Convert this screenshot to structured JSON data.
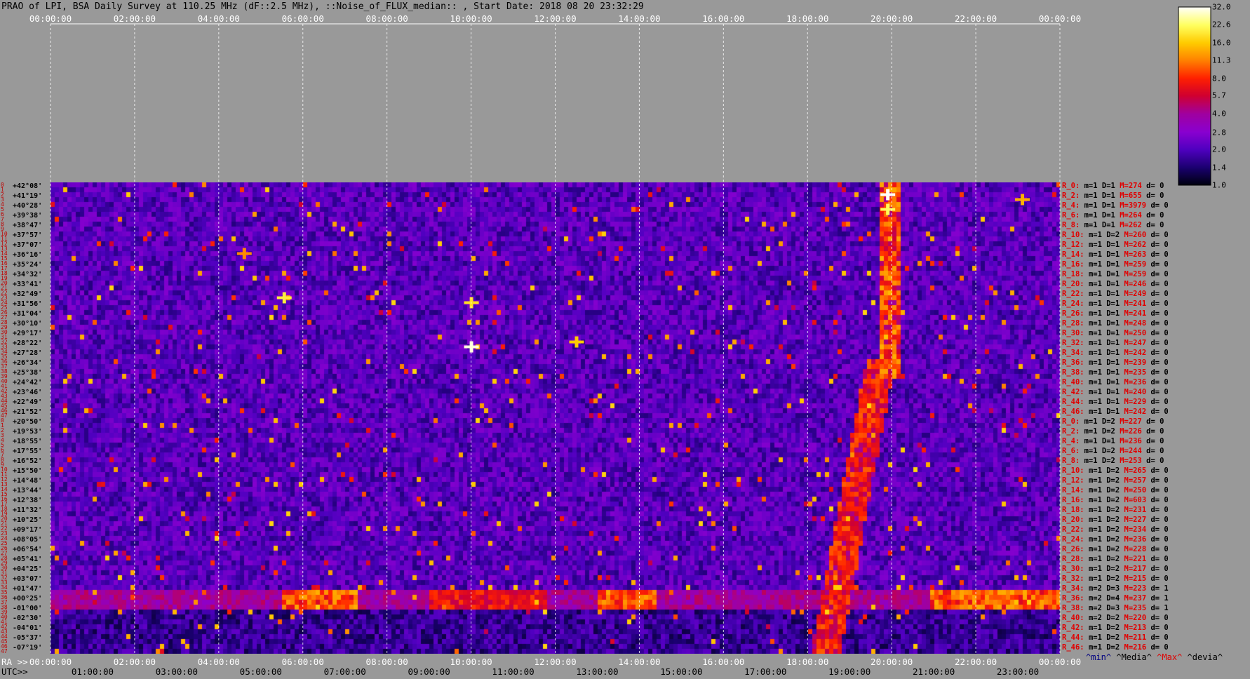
{
  "title": "PRAO of LPI, BSA Daily Survey at 110.25 MHz (dF::2.5 MHz), ::Noise_of_FLUX_median:: , Start Date: 2018 08 20 23:32:29",
  "chart_data": {
    "type": "heatmap",
    "title": "PRAO of LPI, BSA Daily Survey at 110.25 MHz (dF::2.5 MHz), ::Noise_of_FLUX_median:: , Start Date: 2018 08 20 23:32:29",
    "top_ticks": [
      "00:00:00",
      "02:00:00",
      "04:00:00",
      "06:00:00",
      "08:00:00",
      "10:00:00",
      "12:00:00",
      "14:00:00",
      "16:00:00",
      "18:00:00",
      "20:00:00",
      "22:00:00",
      "00:00:00"
    ],
    "ra_prefix": "RA >>",
    "ra_ticks": [
      "00:00:00",
      "02:00:00",
      "04:00:00",
      "06:00:00",
      "08:00:00",
      "10:00:00",
      "12:00:00",
      "14:00:00",
      "16:00:00",
      "18:00:00",
      "20:00:00",
      "22:00:00",
      "00:00:00"
    ],
    "utc_prefix": "UTC>>",
    "utc_ticks": [
      "01:00:00",
      "03:00:00",
      "05:00:00",
      "07:00:00",
      "09:00:00",
      "11:00:00",
      "13:00:00",
      "15:00:00",
      "17:00:00",
      "19:00:00",
      "21:00:00",
      "23:00:00"
    ],
    "declinations": [
      "+42°08'",
      "+41°19'",
      "+40°28'",
      "+39°38'",
      "+38°47'",
      "+37°57'",
      "+37°07'",
      "+36°16'",
      "+35°24'",
      "+34°32'",
      "+33°41'",
      "+32°49'",
      "+31°56'",
      "+31°04'",
      "+30°10'",
      "+29°17'",
      "+28°22'",
      "+27°28'",
      "+26°34'",
      "+25°38'",
      "+24°42'",
      "+23°46'",
      "+22°49'",
      "+21°52'",
      "+20°50'",
      "+19°53'",
      "+18°55'",
      "+17°55'",
      "+16°52'",
      "+15°50'",
      "+14°48'",
      "+13°44'",
      "+12°38'",
      "+11°32'",
      "+10°25'",
      "+09°17'",
      "+08°05'",
      "+06°54'",
      "+05°41'",
      "+04°25'",
      "+03°07'",
      "+01°47'",
      "+00°25'",
      "-01°00'",
      "-02°30'",
      "-04°01'",
      "-05°37'",
      "-07°19'"
    ],
    "row_indices": [
      "0",
      "1",
      "2",
      "3",
      "4",
      "5",
      "6",
      "7",
      "8",
      "9",
      "10",
      "11",
      "12",
      "13",
      "14",
      "15",
      "16",
      "17",
      "18",
      "19",
      "20",
      "21",
      "22",
      "23",
      "24",
      "25",
      "26",
      "27",
      "28",
      "29",
      "30",
      "31",
      "32",
      "33",
      "34",
      "35",
      "36",
      "37",
      "38",
      "39",
      "40",
      "41",
      "42",
      "43",
      "44",
      "45",
      "46",
      "47",
      "0",
      "1",
      "2",
      "3",
      "4",
      "5",
      "6",
      "7",
      "8",
      "9",
      "10",
      "11",
      "12",
      "13",
      "14",
      "15",
      "16",
      "17",
      "18",
      "19",
      "20",
      "21",
      "22",
      "23",
      "24",
      "25",
      "26",
      "27",
      "28",
      "29",
      "30",
      "31",
      "32",
      "33",
      "34",
      "35",
      "36",
      "37",
      "38",
      "39",
      "40",
      "41",
      "42",
      "43",
      "44",
      "45",
      "46",
      "47"
    ],
    "row_stats": [
      {
        "r": "R_0:",
        "m": "m=1",
        "d": "D=1",
        "M": "M=274",
        "dv": "d= 0"
      },
      {
        "r": "R_2:",
        "m": "m=1",
        "d": "D=1",
        "M": "M=655",
        "dv": "d= 0"
      },
      {
        "r": "R_4:",
        "m": "m=1",
        "d": "D=1",
        "M": "M=3979",
        "dv": "d= 0"
      },
      {
        "r": "R_6:",
        "m": "m=1",
        "d": "D=1",
        "M": "M=264",
        "dv": "d= 0"
      },
      {
        "r": "R_8:",
        "m": "m=1",
        "d": "D=1",
        "M": "M=262",
        "dv": "d= 0"
      },
      {
        "r": "R_10:",
        "m": "m=1",
        "d": "D=2",
        "M": "M=260",
        "dv": "d= 0"
      },
      {
        "r": "R_12:",
        "m": "m=1",
        "d": "D=1",
        "M": "M=262",
        "dv": "d= 0"
      },
      {
        "r": "R_14:",
        "m": "m=1",
        "d": "D=1",
        "M": "M=263",
        "dv": "d= 0"
      },
      {
        "r": "R_16:",
        "m": "m=1",
        "d": "D=1",
        "M": "M=259",
        "dv": "d= 0"
      },
      {
        "r": "R_18:",
        "m": "m=1",
        "d": "D=1",
        "M": "M=259",
        "dv": "d= 0"
      },
      {
        "r": "R_20:",
        "m": "m=1",
        "d": "D=1",
        "M": "M=246",
        "dv": "d= 0"
      },
      {
        "r": "R_22:",
        "m": "m=1",
        "d": "D=1",
        "M": "M=249",
        "dv": "d= 0"
      },
      {
        "r": "R_24:",
        "m": "m=1",
        "d": "D=1",
        "M": "M=241",
        "dv": "d= 0"
      },
      {
        "r": "R_26:",
        "m": "m=1",
        "d": "D=1",
        "M": "M=241",
        "dv": "d= 0"
      },
      {
        "r": "R_28:",
        "m": "m=1",
        "d": "D=1",
        "M": "M=248",
        "dv": "d= 0"
      },
      {
        "r": "R_30:",
        "m": "m=1",
        "d": "D=1",
        "M": "M=250",
        "dv": "d= 0"
      },
      {
        "r": "R_32:",
        "m": "m=1",
        "d": "D=1",
        "M": "M=247",
        "dv": "d= 0"
      },
      {
        "r": "R_34:",
        "m": "m=1",
        "d": "D=1",
        "M": "M=242",
        "dv": "d= 0"
      },
      {
        "r": "R_36:",
        "m": "m=1",
        "d": "D=1",
        "M": "M=239",
        "dv": "d= 0"
      },
      {
        "r": "R_38:",
        "m": "m=1",
        "d": "D=1",
        "M": "M=235",
        "dv": "d= 0"
      },
      {
        "r": "R_40:",
        "m": "m=1",
        "d": "D=1",
        "M": "M=236",
        "dv": "d= 0"
      },
      {
        "r": "R_42:",
        "m": "m=1",
        "d": "D=1",
        "M": "M=240",
        "dv": "d= 0"
      },
      {
        "r": "R_44:",
        "m": "m=1",
        "d": "D=1",
        "M": "M=229",
        "dv": "d= 0"
      },
      {
        "r": "R_46:",
        "m": "m=1",
        "d": "D=1",
        "M": "M=242",
        "dv": "d= 0"
      },
      {
        "r": "R_0:",
        "m": "m=1",
        "d": "D=2",
        "M": "M=227",
        "dv": "d= 0"
      },
      {
        "r": "R_2:",
        "m": "m=1",
        "d": "D=2",
        "M": "M=226",
        "dv": "d= 0"
      },
      {
        "r": "R_4:",
        "m": "m=1",
        "d": "D=1",
        "M": "M=236",
        "dv": "d= 0"
      },
      {
        "r": "R_6:",
        "m": "m=1",
        "d": "D=2",
        "M": "M=244",
        "dv": "d= 0"
      },
      {
        "r": "R_8:",
        "m": "m=1",
        "d": "D=2",
        "M": "M=253",
        "dv": "d= 0"
      },
      {
        "r": "R_10:",
        "m": "m=1",
        "d": "D=2",
        "M": "M=265",
        "dv": "d= 0"
      },
      {
        "r": "R_12:",
        "m": "m=1",
        "d": "D=2",
        "M": "M=257",
        "dv": "d= 0"
      },
      {
        "r": "R_14:",
        "m": "m=1",
        "d": "D=2",
        "M": "M=250",
        "dv": "d= 0"
      },
      {
        "r": "R_16:",
        "m": "m=1",
        "d": "D=2",
        "M": "M=603",
        "dv": "d= 0"
      },
      {
        "r": "R_18:",
        "m": "m=1",
        "d": "D=2",
        "M": "M=231",
        "dv": "d= 0"
      },
      {
        "r": "R_20:",
        "m": "m=1",
        "d": "D=2",
        "M": "M=227",
        "dv": "d= 0"
      },
      {
        "r": "R_22:",
        "m": "m=1",
        "d": "D=2",
        "M": "M=234",
        "dv": "d= 0"
      },
      {
        "r": "R_24:",
        "m": "m=1",
        "d": "D=2",
        "M": "M=236",
        "dv": "d= 0"
      },
      {
        "r": "R_26:",
        "m": "m=1",
        "d": "D=2",
        "M": "M=228",
        "dv": "d= 0"
      },
      {
        "r": "R_28:",
        "m": "m=1",
        "d": "D=2",
        "M": "M=221",
        "dv": "d= 0"
      },
      {
        "r": "R_30:",
        "m": "m=1",
        "d": "D=2",
        "M": "M=217",
        "dv": "d= 0"
      },
      {
        "r": "R_32:",
        "m": "m=1",
        "d": "D=2",
        "M": "M=215",
        "dv": "d= 0"
      },
      {
        "r": "R_34:",
        "m": "m=2",
        "d": "D=3",
        "M": "M=223",
        "dv": "d= 1"
      },
      {
        "r": "R_36:",
        "m": "m=2",
        "d": "D=4",
        "M": "M=237",
        "dv": "d= 1"
      },
      {
        "r": "R_38:",
        "m": "m=2",
        "d": "D=3",
        "M": "M=235",
        "dv": "d= 1"
      },
      {
        "r": "R_40:",
        "m": "m=2",
        "d": "D=2",
        "M": "M=220",
        "dv": "d= 0"
      },
      {
        "r": "R_42:",
        "m": "m=1",
        "d": "D=2",
        "M": "M=213",
        "dv": "d= 0"
      },
      {
        "r": "R_44:",
        "m": "m=1",
        "d": "D=2",
        "M": "M=211",
        "dv": "d= 0"
      },
      {
        "r": "R_46:",
        "m": "m=1",
        "d": "D=2",
        "M": "M=216",
        "dv": "d= 0"
      }
    ],
    "colorbar_ticks": [
      "32.0",
      "22.6",
      "16.0",
      "11.3",
      "8.0",
      "5.7",
      "4.0",
      "2.8",
      "2.0",
      "1.4",
      "1.0"
    ],
    "colorbar_values": [
      32.0,
      22.6,
      16.0,
      11.3,
      8.0,
      5.7,
      4.0,
      2.8,
      2.0,
      1.4,
      1.0
    ],
    "colorbar_colors": [
      "#fffff8",
      "#ffff60",
      "#ffcc00",
      "#ff8000",
      "#ff2000",
      "#d00030",
      "#a000a0",
      "#8a00d0",
      "#5000c0",
      "#1a0070",
      "#000010"
    ],
    "legend": {
      "min": "^min^",
      "median": "^Media^",
      "max": "^Max^",
      "devia": "^devia^"
    },
    "bright_events": [
      {
        "ra_hours": 19.9,
        "row": 2,
        "value": 32
      },
      {
        "ra_hours": 19.9,
        "row": 5,
        "value": 22
      },
      {
        "ra_hours": 10.0,
        "row": 33,
        "value": 30
      },
      {
        "ra_hours": 5.55,
        "row": 23,
        "value": 20
      },
      {
        "ra_hours": 10.0,
        "row": 24,
        "value": 18
      },
      {
        "ra_hours": 12.5,
        "row": 32,
        "value": 16
      },
      {
        "ra_hours": 4.6,
        "row": 14,
        "value": 12
      },
      {
        "ra_hours": 23.1,
        "row": 3,
        "value": 14
      }
    ]
  }
}
